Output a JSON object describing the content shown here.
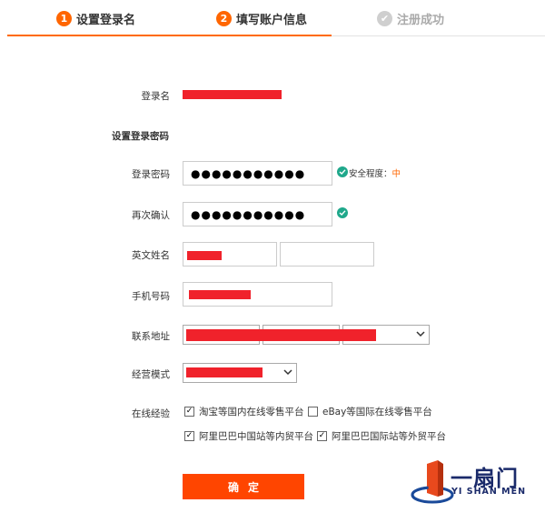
{
  "steps": [
    {
      "number": "1",
      "label": "设置登录名",
      "state": "active"
    },
    {
      "number": "2",
      "label": "填写账户信息",
      "state": "active"
    },
    {
      "number": "✔",
      "label": "注册成功",
      "state": "pending"
    }
  ],
  "form": {
    "login_name_label": "登录名",
    "password_section_title": "设置登录密码",
    "password_label": "登录密码",
    "password_value": "●●●●●●●●●●●",
    "strength_label": "安全程度：",
    "strength_level": "中",
    "confirm_label": "再次确认",
    "confirm_value": "●●●●●●●●●●●",
    "english_name_label": "英文姓名",
    "phone_label": "手机号码",
    "address_label": "联系地址",
    "business_mode_label": "经营模式",
    "online_exp_label": "在线经验",
    "experience_options": [
      {
        "label": "淘宝等国内在线零售平台",
        "checked": true
      },
      {
        "label": "eBay等国际在线零售平台",
        "checked": false
      },
      {
        "label": "阿里巴巴中国站等内贸平台",
        "checked": true
      },
      {
        "label": "阿里巴巴国际站等外贸平台",
        "checked": true
      }
    ],
    "submit_label": "确定"
  },
  "logo": {
    "name_cn": "一扇门",
    "name_en": "YI SHAN MEN"
  },
  "colors": {
    "accent": "#ff6600",
    "button": "#ff4500",
    "redaction": "#f0222b",
    "check_green": "#1fa88b",
    "brand_navy": "#1a2a6a"
  }
}
